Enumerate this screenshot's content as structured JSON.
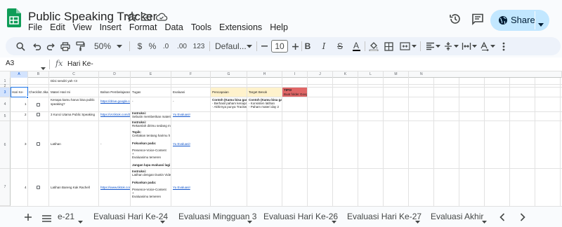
{
  "app": {
    "title": "Public Speaking Tracker",
    "menu": [
      "File",
      "Edit",
      "View",
      "Insert",
      "Format",
      "Data",
      "Tools",
      "Extensions",
      "Help"
    ],
    "share_label": "Share",
    "brand_color": "#0f9d58",
    "accent_color": "#c2e7ff"
  },
  "toolbar": {
    "zoom": "50%",
    "currency": "$",
    "percent": "%",
    "decimal_decrease": ".0",
    "decimal_increase": ".00",
    "number_format": "123",
    "font": "Defaul...",
    "font_size": "10",
    "bold": "B",
    "italic": "I",
    "strikethrough": "S",
    "text_color": "A"
  },
  "formula_bar": {
    "cell_ref": "A3",
    "fx": "fx",
    "content": "Hari Ke-"
  },
  "columns": [
    "A",
    "B",
    "C",
    "D",
    "E",
    "F",
    "G",
    "H",
    "I",
    "J",
    "K",
    "L",
    "M",
    "N"
  ],
  "rows": [
    "1",
    "2",
    "3",
    "4",
    "5",
    "6",
    "7"
  ],
  "cells": {
    "r1_note": "Diisi sendiri yah <3",
    "headers": {
      "hari": "Hari Ke-",
      "checklist": "Checklist Jika Sudah",
      "materi": "Materi Hari Ini",
      "bahan": "Bahan Pembelajaran",
      "tugas": "Tugas",
      "evaluasi": "Evaluasi",
      "pencapaian": "Pencapaian",
      "target": "Target Besok",
      "tips": "TIPS!",
      "tips_sub": "Buat folder Goog"
    },
    "row4": {
      "day": "1",
      "materi": "Kenapa kamu harus bisa public speaking?",
      "bahan": "https://drive.google.co",
      "tugas": "-",
      "evaluasi": "-",
      "pencapaian": "Contoh (Kamu bisa gan",
      "pencapaian_2": "- Berhasil paham kenapa",
      "pencapaian_3": "- Akhirnya punya Tracker",
      "target": "Contoh (Kamu bisa gan",
      "target_2": "- Konsisten latihan",
      "target_3": "- Paham materi day 2"
    },
    "row5": {
      "day": "2",
      "materi": "3 Kunci Utama Public Speaking",
      "bahan": "https://vt.tiktok.com/Z",
      "tugas_1": "Instruksi:",
      "tugas_2": "Sebutin memberikan materi",
      "evaluasi": "Yu Evaluasi!"
    },
    "row6": {
      "day": "3",
      "materi": "Latihan",
      "bahan": "-",
      "tugas_1": "Instruksi:",
      "tugas_2": "Rekamlah dirimu sedang m",
      "tugas_3": "Topik:",
      "tugas_4": "Ceritakan tentang harimu h",
      "tugas_5": "Fokuskan pada:",
      "tugas_6": "Presence-Voice-Content",
      "tugas_7": "+",
      "tugas_8": "Evaluasimu temeren",
      "tugas_9": "Jangan lupa evaluasi lagi",
      "evaluasi": "Yu Evaluasi!"
    },
    "row7": {
      "day": "4",
      "materi": "Latihan Bareng Kak Rachell",
      "bahan": "https://www.tiktok.com",
      "tugas_1": "Instruksi:",
      "tugas_2": "Latihan dengan Dustin Vide",
      "tugas_3": "Fokuskan pada:",
      "tugas_4": "Presence-Voice-Content",
      "tugas_5": "+",
      "tugas_6": "Evaluasimu temeren",
      "evaluasi": "Yu Evaluasi!"
    }
  },
  "sheet_tabs": [
    "e-21",
    "Evaluasi Hari Ke-24",
    "Evaluasi Mingguan 3",
    "Evaluasi Hari Ke-26",
    "Evaluasi Hari Ke-27",
    "Evaluasi Akhir"
  ],
  "colors": {
    "header_yellow": "#fff2cc",
    "header_peach": "#fce5cd",
    "tips_red": "#e06666",
    "selection_blue": "#1a73e8"
  }
}
